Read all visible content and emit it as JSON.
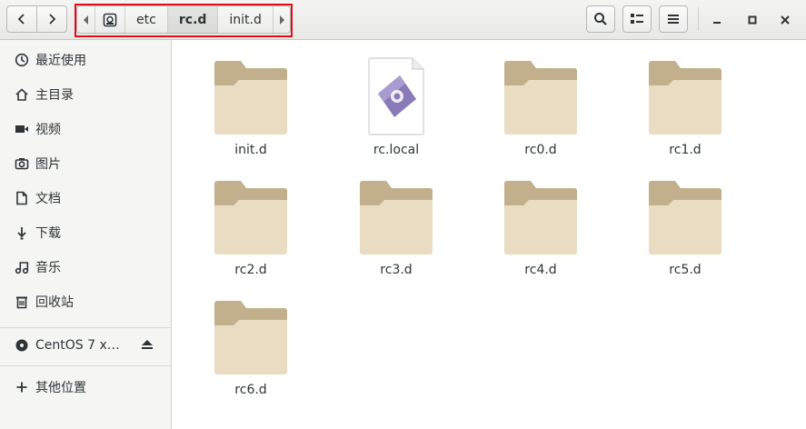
{
  "toolbar": {
    "back": "back",
    "forward": "forward",
    "path": [
      "etc",
      "rc.d",
      "init.d"
    ],
    "active_path": "rc.d"
  },
  "sidebar": {
    "items": [
      {
        "label": "最近使用",
        "icon": "clock-icon"
      },
      {
        "label": "主目录",
        "icon": "home-icon"
      },
      {
        "label": "视频",
        "icon": "video-icon"
      },
      {
        "label": "图片",
        "icon": "camera-icon"
      },
      {
        "label": "文档",
        "icon": "document-icon"
      },
      {
        "label": "下载",
        "icon": "download-icon"
      },
      {
        "label": "音乐",
        "icon": "music-icon"
      },
      {
        "label": "回收站",
        "icon": "trash-icon"
      }
    ],
    "device": {
      "label": "CentOS 7 x…",
      "icon": "disc-icon"
    },
    "other": {
      "label": "其他位置",
      "icon": "plus-icon"
    }
  },
  "files": [
    {
      "name": "init.d",
      "type": "folder"
    },
    {
      "name": "rc.local",
      "type": "script"
    },
    {
      "name": "rc0.d",
      "type": "folder"
    },
    {
      "name": "rc1.d",
      "type": "folder"
    },
    {
      "name": "rc2.d",
      "type": "folder"
    },
    {
      "name": "rc3.d",
      "type": "folder"
    },
    {
      "name": "rc4.d",
      "type": "folder"
    },
    {
      "name": "rc5.d",
      "type": "folder"
    },
    {
      "name": "rc6.d",
      "type": "folder"
    }
  ],
  "colors": {
    "highlight_box": "#e0101a",
    "folder_body": "#e9dcc3",
    "folder_tab": "#c2b08c"
  }
}
